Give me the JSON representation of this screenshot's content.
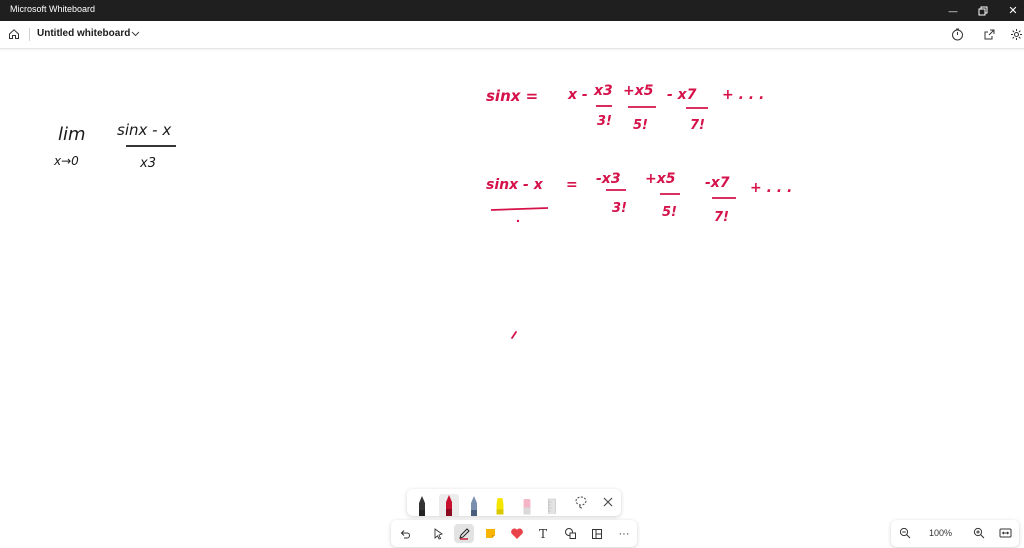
{
  "window": {
    "title": "Microsoft Whiteboard",
    "minimize_glyph": "—",
    "restore_glyph": "❐",
    "close_glyph": "✕"
  },
  "appbar": {
    "board_name": "Untitled whiteboard",
    "icons": [
      "home-icon",
      "chevron-down-icon",
      "timer-icon",
      "share-icon",
      "gear-icon"
    ]
  },
  "ink": {
    "black_color": "#1a1a1a",
    "red_color": "#d6124a",
    "left_expression": {
      "lim": "lim",
      "limit_sub": "x→0",
      "numerator": "sinx - x",
      "denominator": "x3"
    },
    "series_line_1": {
      "lhs": "sinx =",
      "terms": [
        "x -",
        "x3",
        "+x5",
        "- x7",
        "+ . . ."
      ],
      "denominators": [
        "3!",
        "5!",
        "7!"
      ]
    },
    "series_line_2": {
      "lhs": "sinx - x",
      "equals": "=",
      "terms": [
        "-x3",
        "+x5",
        "-x7",
        "+ . . ."
      ],
      "denominators": [
        "3!",
        "5!",
        "7!"
      ]
    }
  },
  "pen_tray": {
    "pens": [
      {
        "name": "black-pen",
        "color": "#222222"
      },
      {
        "name": "red-pen",
        "color": "#c8102e"
      },
      {
        "name": "blue-pen",
        "color": "#7a8fb0"
      },
      {
        "name": "yellow-highlighter",
        "color": "#f5e600"
      },
      {
        "name": "pink-highlighter",
        "color": "#f4b6c6"
      },
      {
        "name": "ruler",
        "color": "#c9c9c9"
      }
    ],
    "icons": [
      "lasso-icon",
      "close-icon"
    ]
  },
  "toolbar": {
    "items": [
      "undo-icon",
      "select-icon",
      "pen-icon",
      "sticky-note-icon",
      "reaction-icon",
      "text-icon",
      "shapes-icon",
      "template-icon",
      "more-icon"
    ],
    "text_tool_label": "T",
    "more_label": "···"
  },
  "zoom": {
    "level": "100%"
  }
}
